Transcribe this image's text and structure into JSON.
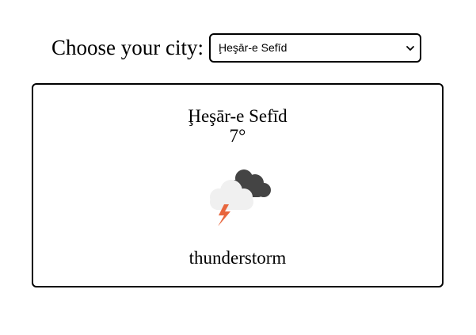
{
  "picker": {
    "label": "Choose your city:",
    "selected_city": "Ḩeşār-e Sefīd"
  },
  "weather": {
    "city": "Ḩeşār-e Sefīd",
    "temperature": "7°",
    "icon": "thunderstorm-icon",
    "condition": "thunderstorm"
  },
  "colors": {
    "border": "#000000",
    "cloud_dark": "#444444",
    "cloud_light": "#f0f0f0",
    "lightning": "#e8663d"
  }
}
